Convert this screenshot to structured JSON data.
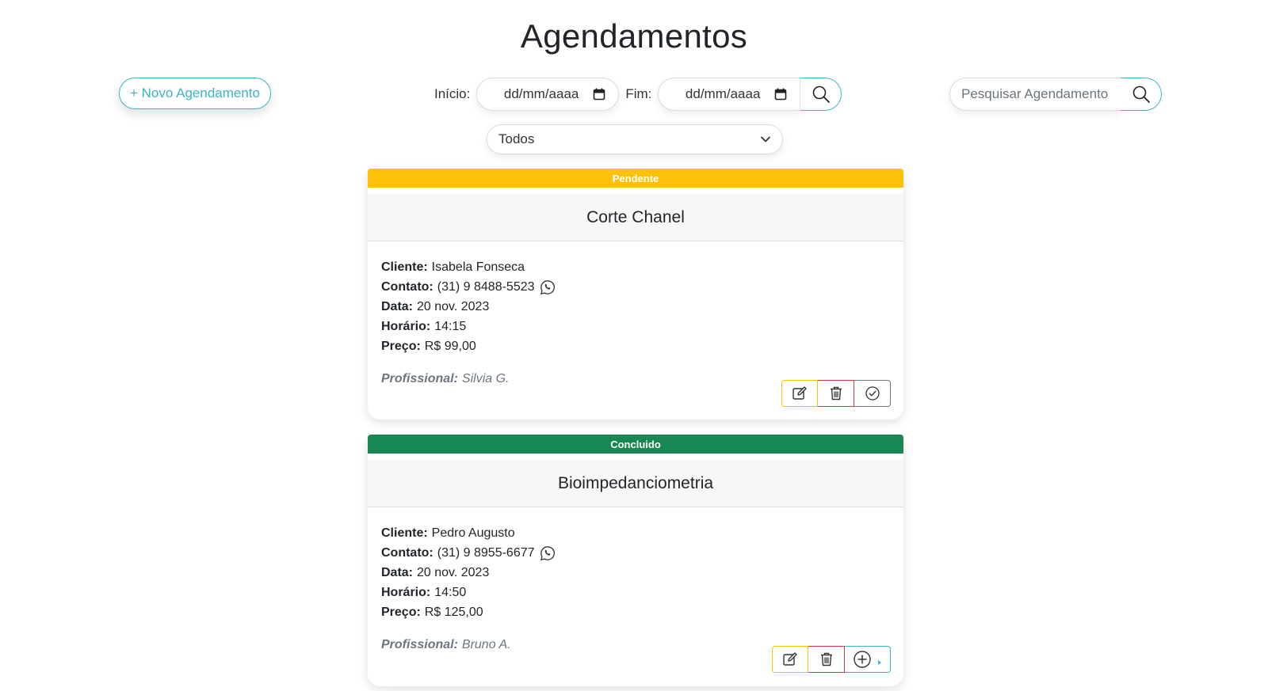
{
  "page": {
    "title": "Agendamentos"
  },
  "toolbar": {
    "new_label": "+ Novo Agendamento",
    "start_label": "Início:",
    "end_label": "Fim:",
    "date_placeholder": "dd/mm/aaaa",
    "search_placeholder": "Pesquisar Agendamento",
    "status_filter": "Todos"
  },
  "labels": {
    "cliente": "Cliente:",
    "contato": "Contato:",
    "data": "Data:",
    "horario": "Horário:",
    "preco": "Preço:",
    "profissional": "Profissional:"
  },
  "appointments": [
    {
      "status": "Pendente",
      "status_color": "#ffc107",
      "service": "Corte Chanel",
      "client": "Isabela Fonseca",
      "contact": "(31) 9 8488-5523",
      "date": "20 nov. 2023",
      "time": "14:15",
      "price": "R$ 99,00",
      "professional": "Silvia G.",
      "actions": [
        "edit-icon",
        "trash-icon",
        "check-circle-icon"
      ]
    },
    {
      "status": "Concluido",
      "status_color": "#198754",
      "service": "Bioimpedanciometria",
      "client": "Pedro Augusto",
      "contact": "(31) 9 8955-6677",
      "date": "20 nov. 2023",
      "time": "14:50",
      "price": "R$ 125,00",
      "professional": "Bruno A.",
      "actions": [
        "edit-icon",
        "trash-icon",
        "plus-circle-icon"
      ]
    }
  ],
  "colors": {
    "accent": "#38b6c8",
    "pending": "#ffc107",
    "done": "#198754",
    "danger": "#dc3545"
  }
}
